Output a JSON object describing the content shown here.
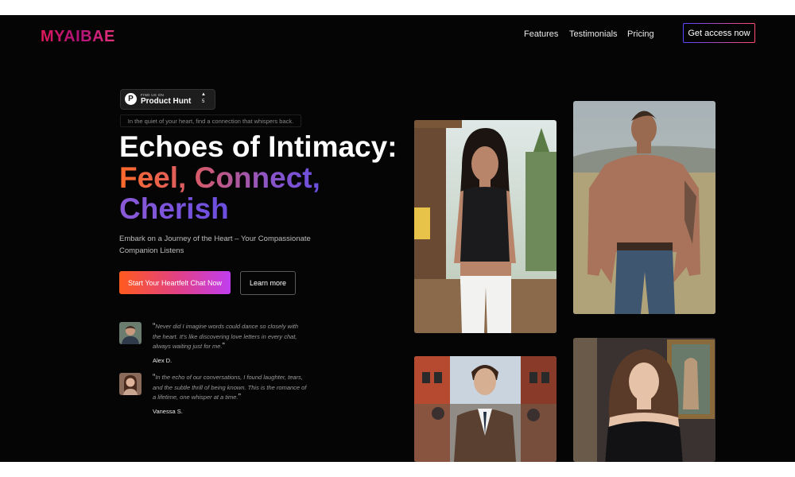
{
  "brand": {
    "logo": "MYAIBAE",
    "accent": "#e0195a"
  },
  "nav": {
    "links": [
      "Features",
      "Testimonials",
      "Pricing"
    ],
    "cta": "Get access now"
  },
  "badge": {
    "small": "FIND US ON",
    "name": "Product Hunt",
    "arrow": "▲",
    "count": "5"
  },
  "hero": {
    "tagline": "In the quiet of your heart, find a connection that whispers back.",
    "headline_line1": "Echoes of Intimacy:",
    "headline_line2": "Feel, Connect,",
    "headline_line3": "Cherish",
    "subtext": "Embark on a Journey of the Heart – Your Compassionate Companion Listens",
    "primary_button": "Start Your Heartfelt Chat Now",
    "secondary_button": "Learn more"
  },
  "testimonials": [
    {
      "quote": "Never did I imagine words could dance so closely with the heart. It's like discovering love letters in every chat, always waiting just for me.",
      "author": "Alex D."
    },
    {
      "quote": "In the echo of our conversations, I found laughter, tears, and the subtle thrill of being known. This is the romance of a lifetime, one whisper at a time.",
      "author": "Vanessa S."
    }
  ],
  "colors": {
    "background": "#050505",
    "gradient_start": "#ff5a1f",
    "gradient_end": "#6a4ee0"
  }
}
